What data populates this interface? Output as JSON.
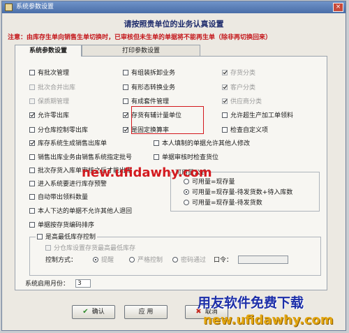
{
  "window": {
    "title": "系统参数设置",
    "close_glyph": "×"
  },
  "heading": "请按照贵单位的业务认真设置",
  "notice": "注意：由库存生单向销售生单切换时，已审核但未生单的单据将不能再生单（除非再切换回来）",
  "tabs": [
    {
      "label": "系统参数设置",
      "active": true
    },
    {
      "label": "打印参数设置",
      "active": false
    }
  ],
  "col1": [
    {
      "label": "有批次管理",
      "checked": false,
      "disabled": false
    },
    {
      "label": "批次合并出库",
      "checked": false,
      "disabled": true
    },
    {
      "label": "保质期管理",
      "checked": false,
      "disabled": true
    },
    {
      "label": "允许零出库",
      "checked": true,
      "disabled": false
    },
    {
      "label": "分仓库控制零出库",
      "checked": false,
      "disabled": false
    },
    {
      "label": "库存系统生成销售出库单",
      "checked": true,
      "disabled": false
    },
    {
      "label": "销售出库业务由销售系统指定批号",
      "checked": false,
      "disabled": false
    },
    {
      "label": "批次存货入库单审核之后才能出库",
      "checked": false,
      "disabled": false
    },
    {
      "label": "进入系统要进行库存预警",
      "checked": false,
      "disabled": false
    },
    {
      "label": "自动带出领料数量",
      "checked": false,
      "disabled": false
    },
    {
      "label": "本人下达的单据不允许其他人退回",
      "checked": false,
      "disabled": false
    },
    {
      "label": "单据按存货编码排序",
      "checked": false,
      "disabled": false
    }
  ],
  "col2": [
    {
      "label": "有组装拆卸业务",
      "checked": false,
      "disabled": false
    },
    {
      "label": "有形态转换业务",
      "checked": false,
      "disabled": false
    },
    {
      "label": "有成套件管理",
      "checked": false,
      "disabled": false
    },
    {
      "label": "存货有辅计量单位",
      "checked": true,
      "disabled": false
    },
    {
      "label": "是固定换算率",
      "checked": true,
      "disabled": false
    },
    {
      "label": "本人填制的单据允许其他人修改",
      "checked": false,
      "disabled": false
    },
    {
      "label": "单据审核时检查货位",
      "checked": false,
      "disabled": false
    }
  ],
  "col3": [
    {
      "label": "存货分类",
      "checked": true,
      "disabled": true
    },
    {
      "label": "客户分类",
      "checked": true,
      "disabled": true
    },
    {
      "label": "供应商分类",
      "checked": true,
      "disabled": true
    },
    {
      "label": "允许超生产加工单领料",
      "checked": false,
      "disabled": false
    },
    {
      "label": "检查自定义项",
      "checked": false,
      "disabled": false
    }
  ],
  "available_qty": {
    "title": "可用量公式",
    "options": [
      {
        "label": "可用量=现存量",
        "selected": false
      },
      {
        "label": "可用量=现存量-待发货数+待入库数",
        "selected": true
      },
      {
        "label": "可用量=现存量-待发货数",
        "selected": false
      }
    ]
  },
  "max_stock": {
    "enable_label": "是高最低库存控制",
    "enable_checked": false,
    "warehouse_label": "分仓库设置存货最高最低库存",
    "control_label": "控制方式：",
    "control_options": [
      {
        "label": "提醒",
        "selected": true
      },
      {
        "label": "严格控制",
        "selected": false
      },
      {
        "label": "密码通过",
        "selected": false
      }
    ],
    "password_label": "口令：",
    "password_value": ""
  },
  "start_month": {
    "label": "系统启用月份：",
    "value": "3"
  },
  "buttons": {
    "ok": "确认",
    "apply": "应 用",
    "cancel": "取消",
    "ok_icon": "✔",
    "apply_icon": "",
    "cancel_icon": "✖"
  },
  "watermarks": {
    "center": "new.ufidawhy.com",
    "corner_title": "用友软件免费下载",
    "corner_url": "new.ufidawhy.com"
  },
  "colors": {
    "notice": "#c4171b",
    "watermark_red": "#d41a1f",
    "watermark_blue": "#1c2ea8",
    "watermark_yellow": "#e2a510"
  }
}
